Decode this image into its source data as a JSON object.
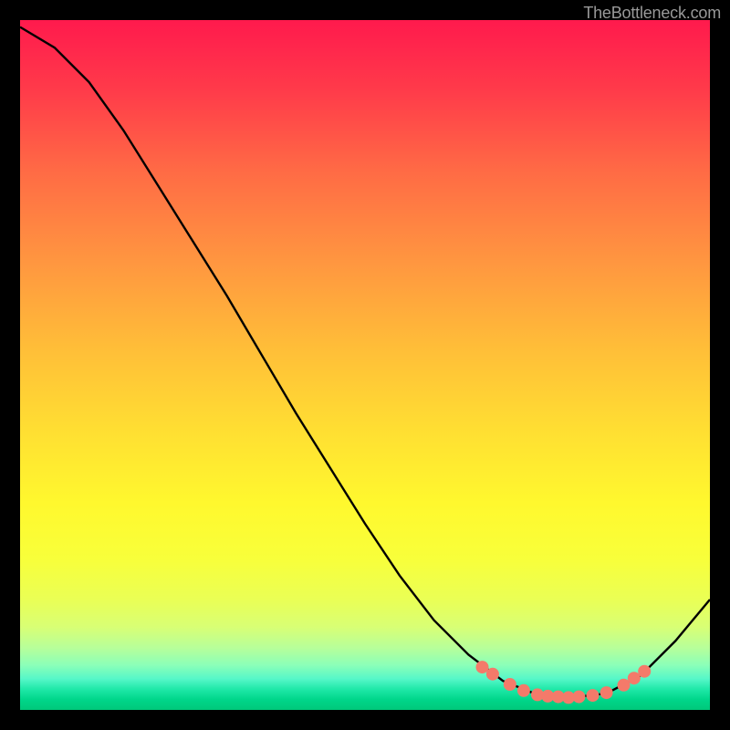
{
  "watermark": "TheBottleneck.com",
  "chart_data": {
    "type": "line",
    "title": "",
    "xlabel": "",
    "ylabel": "",
    "xlim": [
      0,
      100
    ],
    "ylim": [
      0,
      100
    ],
    "curve": {
      "name": "bottleneck-curve",
      "points": [
        {
          "x": 0,
          "y": 99
        },
        {
          "x": 5,
          "y": 96
        },
        {
          "x": 10,
          "y": 91
        },
        {
          "x": 15,
          "y": 84
        },
        {
          "x": 20,
          "y": 76
        },
        {
          "x": 25,
          "y": 68
        },
        {
          "x": 30,
          "y": 60
        },
        {
          "x": 35,
          "y": 51.5
        },
        {
          "x": 40,
          "y": 43
        },
        {
          "x": 45,
          "y": 35
        },
        {
          "x": 50,
          "y": 27
        },
        {
          "x": 55,
          "y": 19.5
        },
        {
          "x": 60,
          "y": 13
        },
        {
          "x": 65,
          "y": 8
        },
        {
          "x": 70,
          "y": 4.2
        },
        {
          "x": 75,
          "y": 2.2
        },
        {
          "x": 80,
          "y": 1.8
        },
        {
          "x": 85,
          "y": 2.4
        },
        {
          "x": 90,
          "y": 5
        },
        {
          "x": 95,
          "y": 10
        },
        {
          "x": 100,
          "y": 16
        }
      ]
    },
    "markers": {
      "name": "trough-markers",
      "color": "#f47a6a",
      "points": [
        {
          "x": 67,
          "y": 6.2
        },
        {
          "x": 68.5,
          "y": 5.2
        },
        {
          "x": 71,
          "y": 3.7
        },
        {
          "x": 73,
          "y": 2.8
        },
        {
          "x": 75,
          "y": 2.2
        },
        {
          "x": 76.5,
          "y": 2.0
        },
        {
          "x": 78,
          "y": 1.9
        },
        {
          "x": 79.5,
          "y": 1.8
        },
        {
          "x": 81,
          "y": 1.9
        },
        {
          "x": 83,
          "y": 2.1
        },
        {
          "x": 85,
          "y": 2.5
        },
        {
          "x": 87.5,
          "y": 3.6
        },
        {
          "x": 89,
          "y": 4.6
        },
        {
          "x": 90.5,
          "y": 5.6
        }
      ]
    },
    "gradient_stops": [
      {
        "pos": 0,
        "color": "#ff1a4d"
      },
      {
        "pos": 0.5,
        "color": "#ffd52e"
      },
      {
        "pos": 0.8,
        "color": "#f5ff40"
      },
      {
        "pos": 1.0,
        "color": "#00c87a"
      }
    ]
  }
}
